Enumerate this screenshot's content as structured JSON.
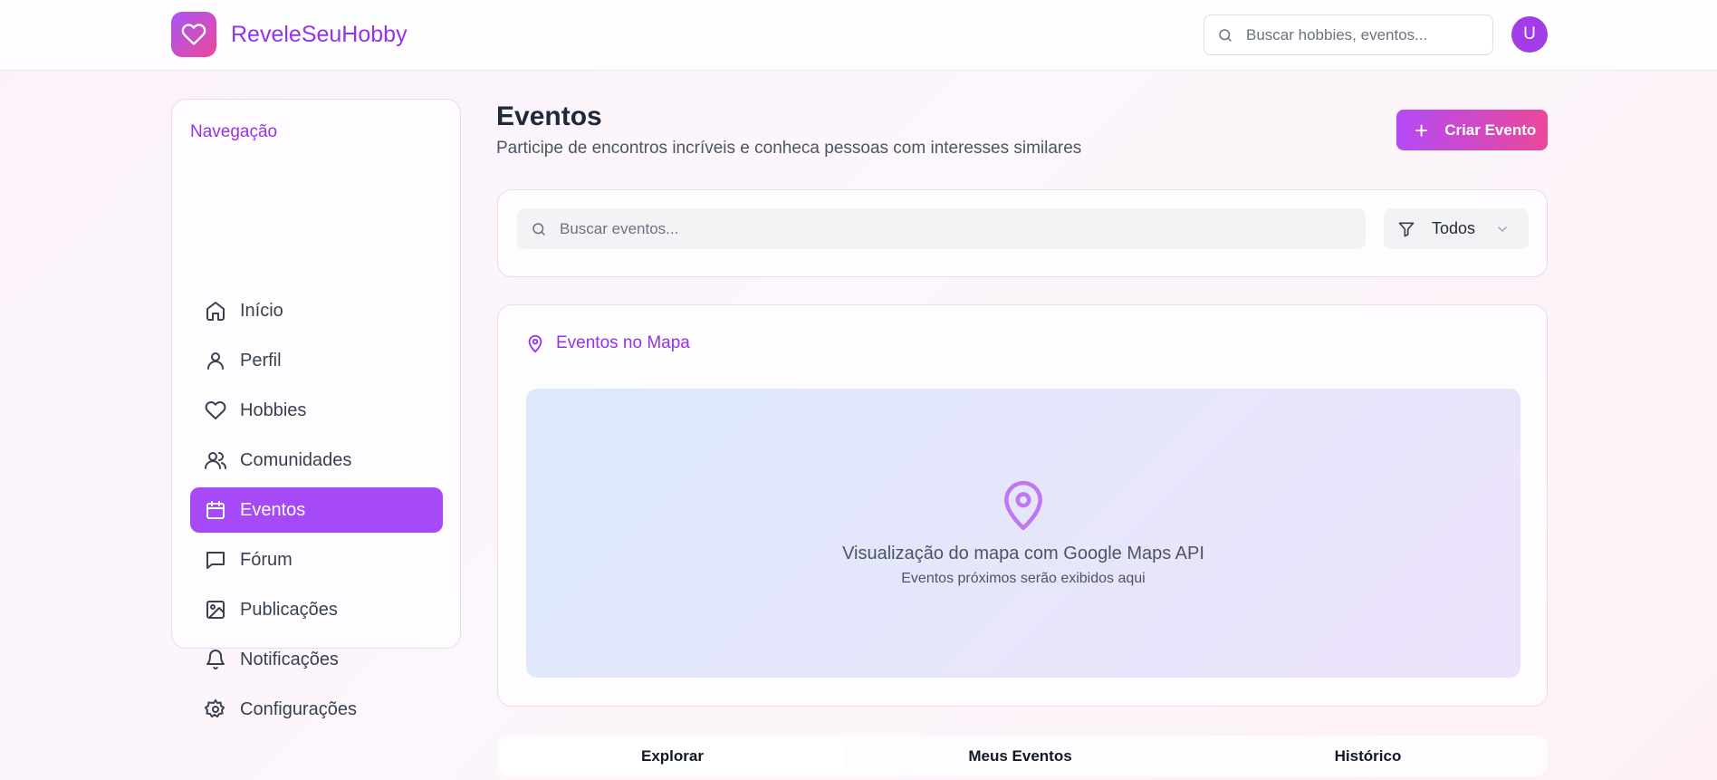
{
  "header": {
    "brand_name": "ReveleSeuHobby",
    "search_placeholder": "Buscar hobbies, eventos...",
    "avatar_initial": "U"
  },
  "sidebar": {
    "title": "Navegação",
    "items": [
      {
        "label": "Início",
        "icon": "home-icon"
      },
      {
        "label": "Perfil",
        "icon": "user-icon"
      },
      {
        "label": "Hobbies",
        "icon": "heart-icon"
      },
      {
        "label": "Comunidades",
        "icon": "users-icon"
      },
      {
        "label": "Eventos",
        "icon": "calendar-icon",
        "active": true
      },
      {
        "label": "Fórum",
        "icon": "message-icon"
      },
      {
        "label": "Publicações",
        "icon": "image-icon"
      },
      {
        "label": "Notificações",
        "icon": "bell-icon"
      },
      {
        "label": "Configurações",
        "icon": "settings-icon"
      }
    ]
  },
  "main": {
    "title": "Eventos",
    "subtitle": "Participe de encontros incríveis e conheca pessoas com interesses similares",
    "create_button": "Criar Evento",
    "search_placeholder": "Buscar eventos...",
    "filter_value": "Todos",
    "map": {
      "title": "Eventos no Mapa",
      "line1": "Visualização do mapa com Google Maps API",
      "line2": "Eventos próximos serão exibidos aqui"
    },
    "tabs": [
      {
        "label": "Explorar",
        "active": true
      },
      {
        "label": "Meus Eventos"
      },
      {
        "label": "Histórico"
      }
    ]
  },
  "colors": {
    "accent": "#9333ea",
    "active_nav": "#a54af6",
    "gradient_start": "#a855f7",
    "gradient_end": "#ec4899"
  }
}
